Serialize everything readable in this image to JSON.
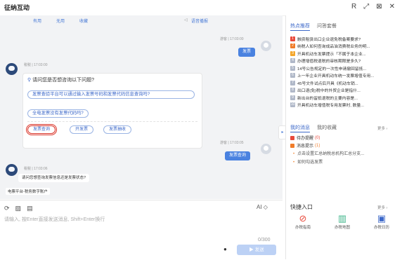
{
  "app": {
    "title": "征纳互动"
  },
  "window_controls": [
    "R",
    "⤢",
    "⊠",
    "✕"
  ],
  "chat": {
    "toolbar": {
      "useful": "有用",
      "useless": "无用",
      "collect": "收藏",
      "listen": "语音播报"
    },
    "user_msg_1": {
      "meta": "游客 | 17:03:00",
      "text": "发票"
    },
    "bot_msg_1": {
      "meta": "税税 | 17:03:00",
      "question": "请问您是否想咨询以下问题?",
      "suggestions": [
        "发票查验平台可以通过输入发票号码和发票代码信息查询吗?",
        "全电发票没有发票代码吗?"
      ],
      "chips": [
        "发票查询",
        "开发票",
        "发票抽收"
      ]
    },
    "user_msg_2": {
      "meta": "游客 | 17:03:05",
      "text": "发票查询"
    },
    "bot_msg_2": {
      "meta": "税税 | 17:03:06",
      "text": "请问您想查询发票信息还是发票状态?"
    },
    "account": "电票平台-税务数字账户"
  },
  "input": {
    "placeholder": "请输入, 按Enter直接发送消息, Shift+Enter换行",
    "ai_label": "AI",
    "counter": "0/300",
    "send_label": "发送"
  },
  "sidebar": {
    "tabs": [
      "热点推荐",
      "问答套餐"
    ],
    "hot_items": [
      {
        "num": "1",
        "text": "融资租赁出口企业退免税备案要求?",
        "color": "#e84a3c"
      },
      {
        "num": "2",
        "text": "纳税人如何查询成品油消费税业务的明...",
        "color": "#f07c2a"
      },
      {
        "num": "3",
        "text": "开具机动车发票提示「不属于本企业...",
        "color": "#f4a62a"
      },
      {
        "num": "4",
        "text": "办理增值税退税的审核期限是多久?",
        "color": "#b0b8c8"
      },
      {
        "num": "5",
        "text": "14号公告规定的一次性申请撤回留抵...",
        "color": "#b0b8c8"
      },
      {
        "num": "6",
        "text": "上一年企业开具机动车统一发票增值专用...",
        "color": "#b0b8c8"
      },
      {
        "num": "7",
        "text": "45号文件试点后开具《机动车销...",
        "color": "#b0b8c8"
      },
      {
        "num": "8",
        "text": "出口退(免)税中的外贸企业是指什...",
        "color": "#b0b8c8"
      },
      {
        "num": "9",
        "text": "新出台的留抵退税的主要内容是...",
        "color": "#b0b8c8"
      },
      {
        "num": "10",
        "text": "开具机动车增值税专用发票时, 数量...",
        "color": "#b0b8c8"
      }
    ],
    "my_messages": {
      "title": "我的消息",
      "collect": "我的收藏",
      "more": "更多 ›",
      "rows": [
        {
          "label": "待办提醒",
          "count": "(0)",
          "color": "#e84a3c"
        },
        {
          "label": "消息提示",
          "count": "(1)",
          "color": "#f07c2a"
        }
      ],
      "bullets": [
        "点击设置汇总纳税总机构汇总分支...",
        "如何勾选发票"
      ]
    },
    "quick": {
      "title": "快捷入口",
      "more": "更多 ›",
      "items": [
        {
          "icon": "compass-icon",
          "glyph": "⊘",
          "label": "办税指南",
          "color": "#e84a3c"
        },
        {
          "icon": "map-icon",
          "glyph": "▥",
          "label": "办税地图",
          "color": "#3fb58a"
        },
        {
          "icon": "calendar-icon",
          "glyph": "▣",
          "label": "办税日历",
          "color": "#3c68c9"
        }
      ]
    }
  }
}
